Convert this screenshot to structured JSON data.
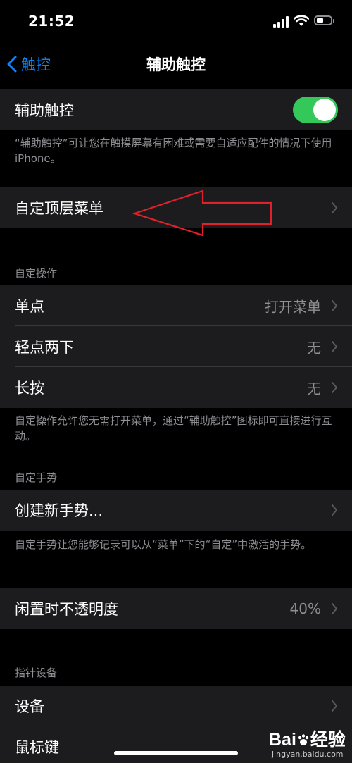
{
  "status": {
    "time": "21:52"
  },
  "nav": {
    "back_label": "触控",
    "title": "辅助触控"
  },
  "assistive_touch": {
    "label": "辅助触控",
    "toggle_on": true,
    "footer": "“辅助触控”可让您在触摸屏幕有困难或需要自适应配件的情况下使用iPhone。"
  },
  "top_menu": {
    "label": "自定顶层菜单"
  },
  "custom_actions": {
    "header": "自定操作",
    "items": [
      {
        "label": "单点",
        "value": "打开菜单"
      },
      {
        "label": "轻点两下",
        "value": "无"
      },
      {
        "label": "长按",
        "value": "无"
      }
    ],
    "footer": "自定操作允许您无需打开菜单，通过“辅助触控”图标即可直接进行互动。"
  },
  "custom_gestures": {
    "header": "自定手势",
    "create_label": "创建新手势...",
    "footer": "自定手势让您能够记录可以从“菜单”下的“自定”中激活的手势。"
  },
  "idle_opacity": {
    "label": "闲置时不透明度",
    "value": "40%"
  },
  "pointer_devices": {
    "header": "指针设备",
    "items": [
      {
        "label": "设备"
      },
      {
        "label": "鼠标键"
      }
    ]
  },
  "watermark": {
    "logo_text_a": "Bai",
    "logo_text_b": "经验",
    "url": "jingyan.baidu.com"
  },
  "colors": {
    "accent": "#0a84ff",
    "toggle": "#34c759",
    "arrow": "#e0202a",
    "cell_bg": "#1c1c1e"
  }
}
